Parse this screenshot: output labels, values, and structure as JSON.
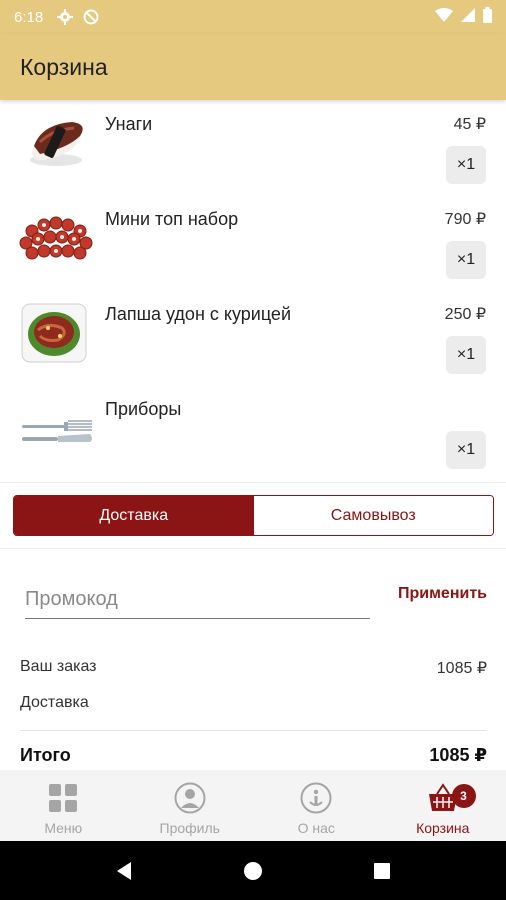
{
  "status_bar": {
    "time": "6:18"
  },
  "app_bar": {
    "title": "Корзина"
  },
  "cart": {
    "items": [
      {
        "name": "Унаги",
        "price": "45 ₽",
        "qty": "×1"
      },
      {
        "name": "Мини топ набор",
        "price": "790 ₽",
        "qty": "×1"
      },
      {
        "name": "Лапша удон с курицей",
        "price": "250 ₽",
        "qty": "×1"
      },
      {
        "name": "Приборы",
        "price": "",
        "qty": "×1"
      }
    ]
  },
  "delivery_toggle": {
    "delivery": "Доставка",
    "pickup": "Самовывоз",
    "selected": "Доставка"
  },
  "promo": {
    "placeholder": "Промокод",
    "apply_label": "Применить"
  },
  "summary": {
    "order_label": "Ваш заказ",
    "order_value": "1085 ₽",
    "delivery_label": "Доставка",
    "delivery_value": "",
    "total_label": "Итого",
    "total_value": "1085 ₽"
  },
  "bottom_nav": {
    "items": [
      {
        "label": "Меню",
        "icon": "grid-icon"
      },
      {
        "label": "Профиль",
        "icon": "profile-icon"
      },
      {
        "label": "О нас",
        "icon": "info-icon"
      },
      {
        "label": "Корзина",
        "icon": "basket-icon"
      }
    ],
    "active": "Корзина",
    "cart_badge": "3"
  },
  "colors": {
    "accent": "#8b1414",
    "header": "#e4c97e",
    "nav_bg": "#f4f4f4"
  }
}
